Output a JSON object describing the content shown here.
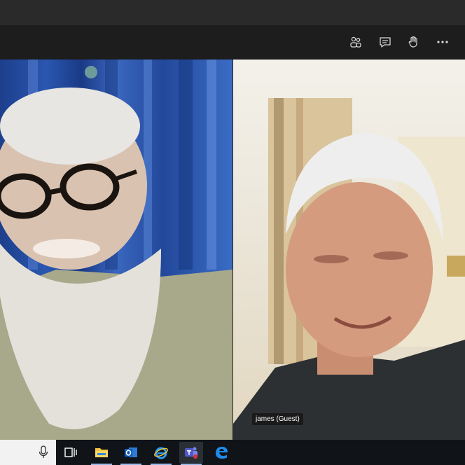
{
  "meeting": {
    "participant_name": "james (Guest)"
  },
  "toolbar": {
    "participants_icon": "participants-icon",
    "chat_icon": "chat-icon",
    "raise_hand_icon": "raise-hand-icon",
    "more_icon": "more-options-icon"
  },
  "taskbar": {
    "apps": [
      "microphone-icon",
      "task-view-icon",
      "file-explorer-icon",
      "outlook-icon",
      "internet-explorer-icon",
      "teams-icon",
      "edge-icon"
    ]
  },
  "colors": {
    "meeting_bar": "#1d1d1d",
    "taskbar": "#101418",
    "left_video_curtain": "#2a57b0",
    "accent": "#6264a7"
  }
}
